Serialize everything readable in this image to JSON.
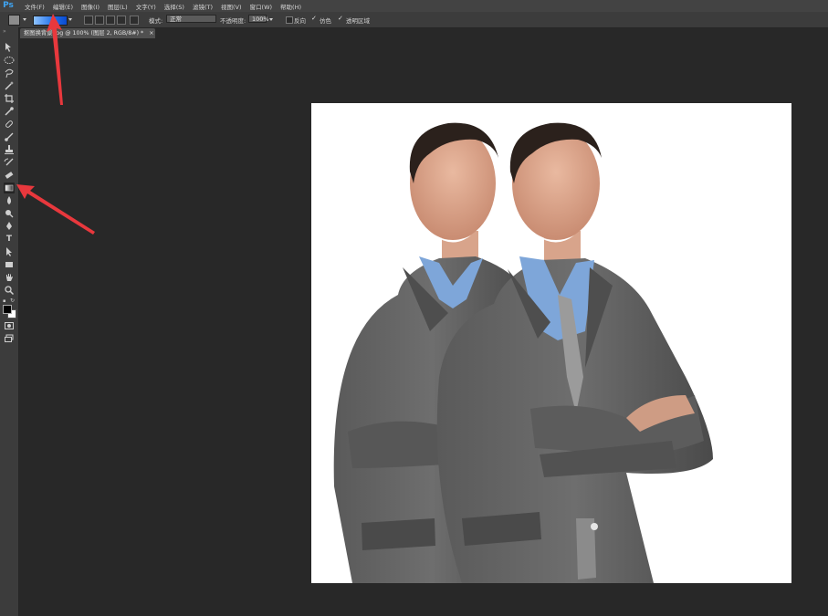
{
  "app": {
    "logo": "Ps"
  },
  "menu": [
    "文件(F)",
    "编辑(E)",
    "图像(I)",
    "图层(L)",
    "文字(Y)",
    "选择(S)",
    "滤镜(T)",
    "视图(V)",
    "窗口(W)",
    "帮助(H)"
  ],
  "options": {
    "mode_label": "模式:",
    "mode_value": "正常",
    "opacity_label": "不透明度:",
    "opacity_value": "100%",
    "reverse_label": "反向",
    "dither_label": "仿色",
    "transparency_label": "透明区域",
    "reverse_checked": false,
    "dither_checked": true,
    "transparency_checked": true
  },
  "document_tab": {
    "title": "抠图换背景.jpg @ 100% (图层 2, RGB/8#) *",
    "close": "×"
  },
  "tools": [
    "move-icon",
    "ellipse-marquee-icon",
    "lasso-icon",
    "magic-wand-icon",
    "crop-icon",
    "eyedropper-icon",
    "healing-brush-icon",
    "brush-icon",
    "clone-stamp-icon",
    "history-brush-icon",
    "eraser-icon",
    "gradient-icon",
    "blur-icon",
    "dodge-icon",
    "pen-icon",
    "type-icon",
    "path-selection-icon",
    "rectangle-icon",
    "hand-icon",
    "zoom-icon"
  ],
  "tool_glyphs": {
    "type": "T"
  },
  "colors": {
    "annotation_arrow": "#e8383d",
    "gradient_start": "#8ec3ff",
    "gradient_end": "#0b4bd1",
    "foreground": "#000000",
    "background": "#ffffff"
  },
  "canvas_image": "two identical men in grey suits with arms crossed on a white background"
}
